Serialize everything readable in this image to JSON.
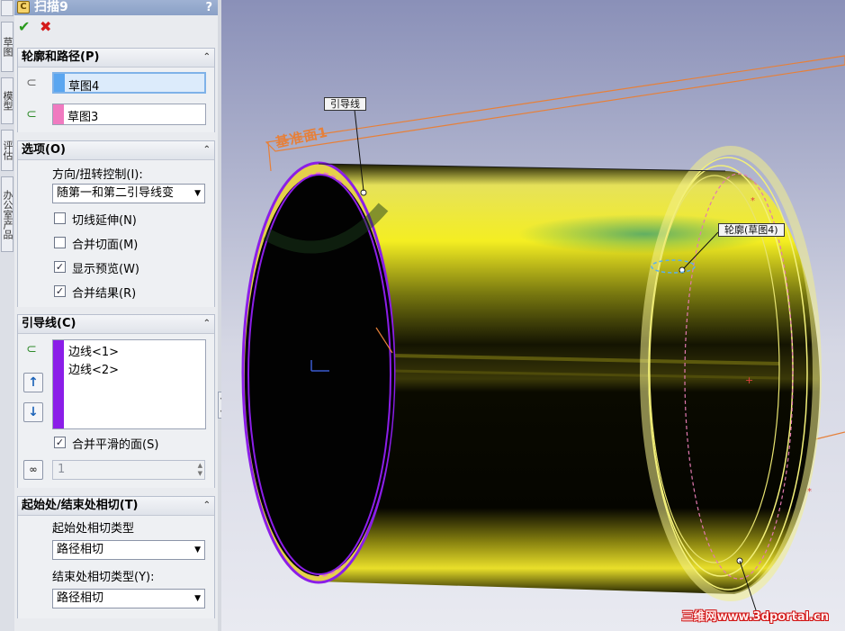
{
  "tabstrip": {
    "tabs": [
      "草图",
      "模型",
      "评估",
      "办公室产品"
    ]
  },
  "pm": {
    "title": "扫描9",
    "help": "?",
    "ok_icon": "check-icon",
    "cancel_icon": "x-icon",
    "profile_path": {
      "header": "轮廓和路径(P)",
      "profile_value": "草图4",
      "path_value": "草图3",
      "profile_color": "#5aa6f0",
      "path_color": "#f07ac0"
    },
    "options": {
      "header": "选项(O)",
      "orientation_label": "方向/扭转控制(I):",
      "orientation_value": "随第一和第二引导线变",
      "checks": [
        {
          "label": "切线延伸(N)",
          "checked": false
        },
        {
          "label": "合并切面(M)",
          "checked": false
        },
        {
          "label": "显示预览(W)",
          "checked": true
        },
        {
          "label": "合并结果(R)",
          "checked": true
        }
      ]
    },
    "guides": {
      "header": "引导线(C)",
      "items": [
        "边线<1>",
        "边线<2>"
      ],
      "color": "#8b1ee8",
      "merge_smooth_label": "合并平滑的面(S)",
      "merge_smooth_checked": true,
      "spin_value": "1"
    },
    "tangency": {
      "header": "起始处/结束处相切(T)",
      "start_label": "起始处相切类型",
      "start_value": "路径相切",
      "end_label": "结束处相切类型(Y):",
      "end_value": "路径相切"
    }
  },
  "viewport": {
    "plane_label": "基准面1",
    "callout_guide": "引导线",
    "callout_profile": "轮廓(草图4)",
    "watermark": "三维网www.3dportal.cn"
  }
}
